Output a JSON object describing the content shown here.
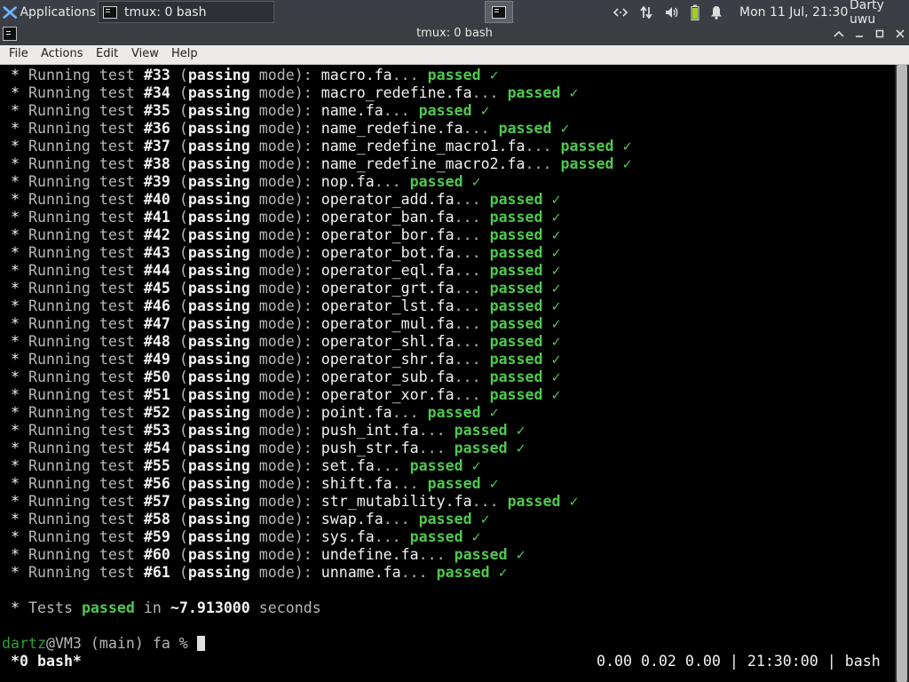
{
  "panel": {
    "applications_label": "Applications",
    "task_label": "tmux: 0 bash",
    "clock": "Mon 11 Jul, 21:30",
    "user": "Darty uwu"
  },
  "window": {
    "title": "tmux: 0 bash"
  },
  "menu": {
    "file": "File",
    "actions": "Actions",
    "edit": "Edit",
    "view": "View",
    "help": "Help"
  },
  "terminal": {
    "prefix": "Running test",
    "mode_word": "passing",
    "mode_suffix": "mode):",
    "passed_word": "passed",
    "check": "✓",
    "tests": [
      {
        "num": "#33",
        "file": "macro.fa"
      },
      {
        "num": "#34",
        "file": "macro_redefine.fa"
      },
      {
        "num": "#35",
        "file": "name.fa"
      },
      {
        "num": "#36",
        "file": "name_redefine.fa"
      },
      {
        "num": "#37",
        "file": "name_redefine_macro1.fa"
      },
      {
        "num": "#38",
        "file": "name_redefine_macro2.fa"
      },
      {
        "num": "#39",
        "file": "nop.fa"
      },
      {
        "num": "#40",
        "file": "operator_add.fa"
      },
      {
        "num": "#41",
        "file": "operator_ban.fa"
      },
      {
        "num": "#42",
        "file": "operator_bor.fa"
      },
      {
        "num": "#43",
        "file": "operator_bot.fa"
      },
      {
        "num": "#44",
        "file": "operator_eql.fa"
      },
      {
        "num": "#45",
        "file": "operator_grt.fa"
      },
      {
        "num": "#46",
        "file": "operator_lst.fa"
      },
      {
        "num": "#47",
        "file": "operator_mul.fa"
      },
      {
        "num": "#48",
        "file": "operator_shl.fa"
      },
      {
        "num": "#49",
        "file": "operator_shr.fa"
      },
      {
        "num": "#50",
        "file": "operator_sub.fa"
      },
      {
        "num": "#51",
        "file": "operator_xor.fa"
      },
      {
        "num": "#52",
        "file": "point.fa"
      },
      {
        "num": "#53",
        "file": "push_int.fa"
      },
      {
        "num": "#54",
        "file": "push_str.fa"
      },
      {
        "num": "#55",
        "file": "set.fa"
      },
      {
        "num": "#56",
        "file": "shift.fa"
      },
      {
        "num": "#57",
        "file": "str_mutability.fa"
      },
      {
        "num": "#58",
        "file": "swap.fa"
      },
      {
        "num": "#59",
        "file": "sys.fa"
      },
      {
        "num": "#60",
        "file": "undefine.fa"
      },
      {
        "num": "#61",
        "file": "unname.fa"
      }
    ],
    "summary": {
      "tests_label": "Tests",
      "passed_word": "passed",
      "in_word": "in",
      "time": "~7.913000",
      "seconds_word": "seconds"
    },
    "prompt": {
      "user": "dartz",
      "host_part": "@VM3 (main) fa %"
    },
    "status": {
      "session": "*0 bash*",
      "right": "0.00 0.02 0.00 | 21:30:00 | bash"
    }
  },
  "colors": {
    "passed": "#4ec94e",
    "prompt_user": "#2ea02e",
    "panel_bg": "#3b3f45"
  }
}
